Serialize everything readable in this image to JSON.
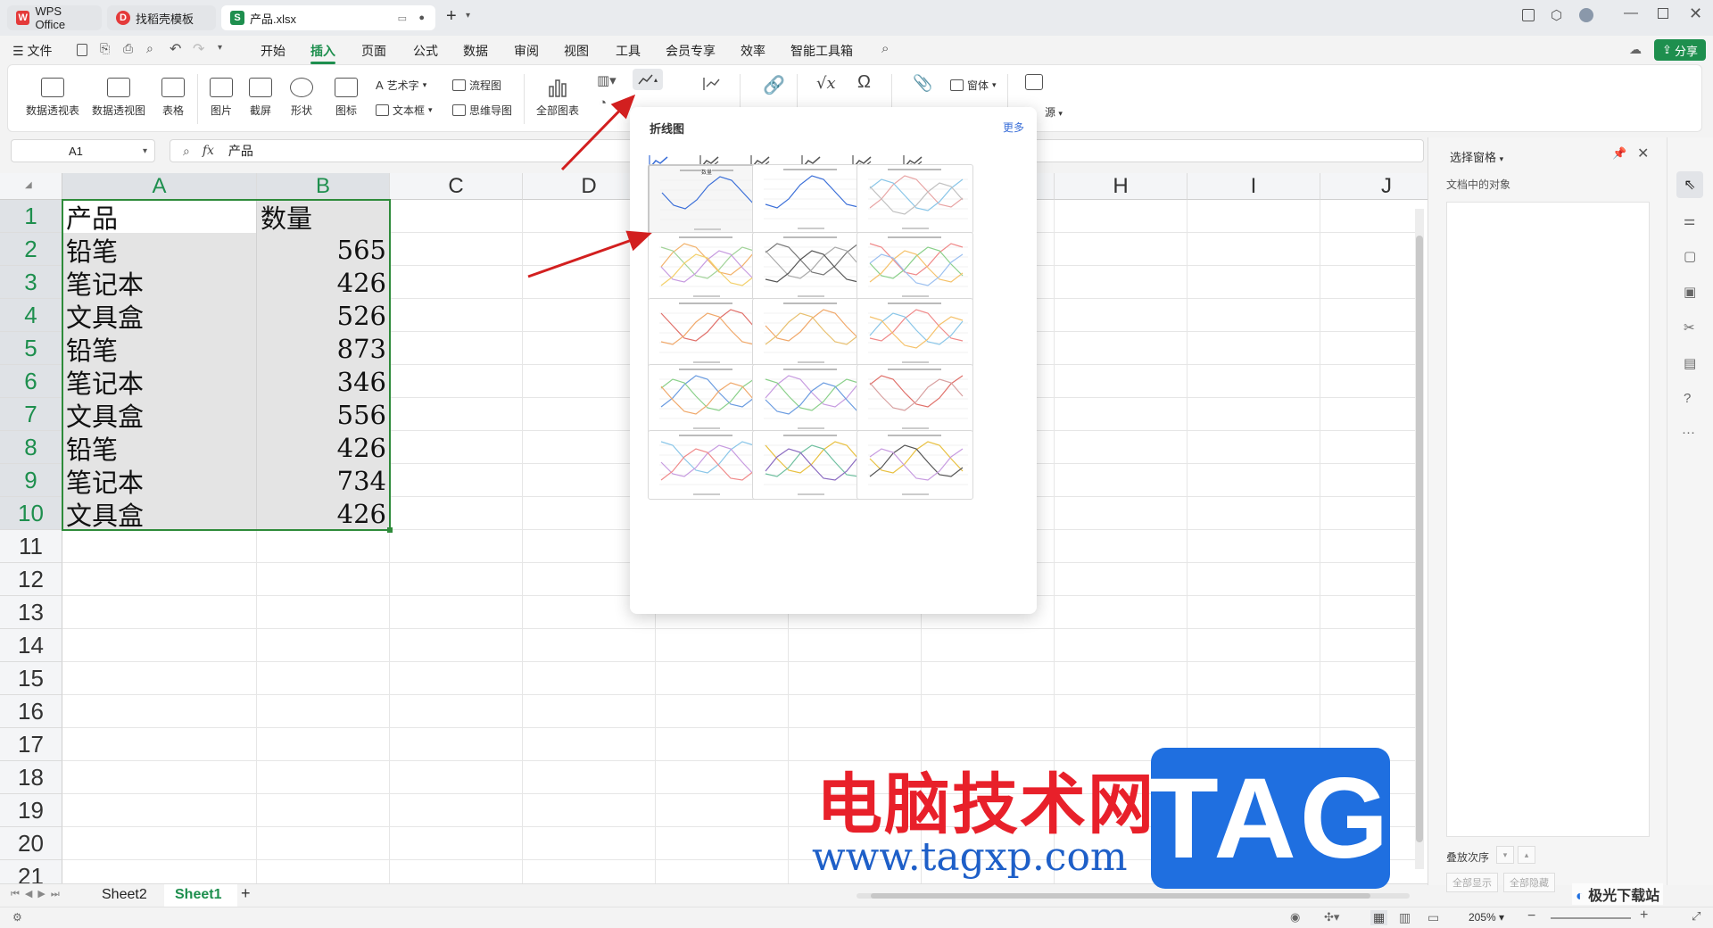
{
  "titlebar": {
    "tabs": [
      {
        "label": "WPS Office",
        "icon": "wps-logo-icon"
      },
      {
        "label": "找稻壳模板",
        "icon": "docer-icon"
      },
      {
        "label": "产品.xlsx",
        "icon": "sheet-icon"
      }
    ]
  },
  "menubar": {
    "file": "文件",
    "items": [
      "开始",
      "插入",
      "页面",
      "公式",
      "数据",
      "审阅",
      "视图",
      "工具",
      "会员专享",
      "效率",
      "智能工具箱"
    ],
    "active": "插入",
    "share": "分享"
  },
  "ribbon": {
    "pivot_table": "数据透视表",
    "pivot_chart": "数据透视图",
    "table": "表格",
    "picture": "图片",
    "screenshot": "截屏",
    "shape": "形状",
    "icon": "图标",
    "wordart": "艺术字",
    "textbox": "文本框",
    "flowchart": "流程图",
    "mindmap": "思维导图",
    "all_charts": "全部图表",
    "form": "窗体",
    "source_partial": "源"
  },
  "formula_bar": {
    "name_box": "A1",
    "fx": "fx",
    "value": "产品"
  },
  "sheet": {
    "columns": [
      "A",
      "B",
      "C",
      "D",
      "E",
      "F",
      "G",
      "H",
      "I",
      "J"
    ],
    "rows": [
      "1",
      "2",
      "3",
      "4",
      "5",
      "6",
      "7",
      "8",
      "9",
      "10",
      "11",
      "12",
      "13",
      "14",
      "15",
      "16",
      "17",
      "18",
      "19",
      "20",
      "21"
    ],
    "data": [
      [
        "产品",
        "数量"
      ],
      [
        "铅笔",
        "565"
      ],
      [
        "笔记本",
        "426"
      ],
      [
        "文具盒",
        "526"
      ],
      [
        "铅笔",
        "873"
      ],
      [
        "笔记本",
        "346"
      ],
      [
        "文具盒",
        "556"
      ],
      [
        "铅笔",
        "426"
      ],
      [
        "笔记本",
        "734"
      ],
      [
        "文具盒",
        "426"
      ]
    ]
  },
  "dropdown": {
    "title": "折线图",
    "more": "更多",
    "chart_type_icons": [
      "line-chart-icon",
      "stacked-line-icon",
      "percent-line-icon",
      "marker-line-icon",
      "stacked-marker-line-icon",
      "percent-marker-line-icon"
    ],
    "selected_thumb_title": "数量"
  },
  "sheet_tabs": {
    "tabs": [
      "Sheet2",
      "Sheet1"
    ],
    "active": "Sheet1",
    "add": "+"
  },
  "right_pane": {
    "title": "选择窗格",
    "subtitle": "文档中的对象",
    "order_label": "叠放次序",
    "show_all": "全部显示",
    "hide_all": "全部隐藏"
  },
  "status": {
    "zoom": "205%"
  },
  "watermark": {
    "cn": "电脑技术网",
    "url": "www.tagxp.com",
    "tag": "TAG",
    "corner": "极光下载站"
  },
  "colors": {
    "accent_green": "#1e8f4e",
    "selection_border": "#2e8b3a",
    "arrow": "#d21f1f",
    "link_blue": "#3b6fd8"
  }
}
